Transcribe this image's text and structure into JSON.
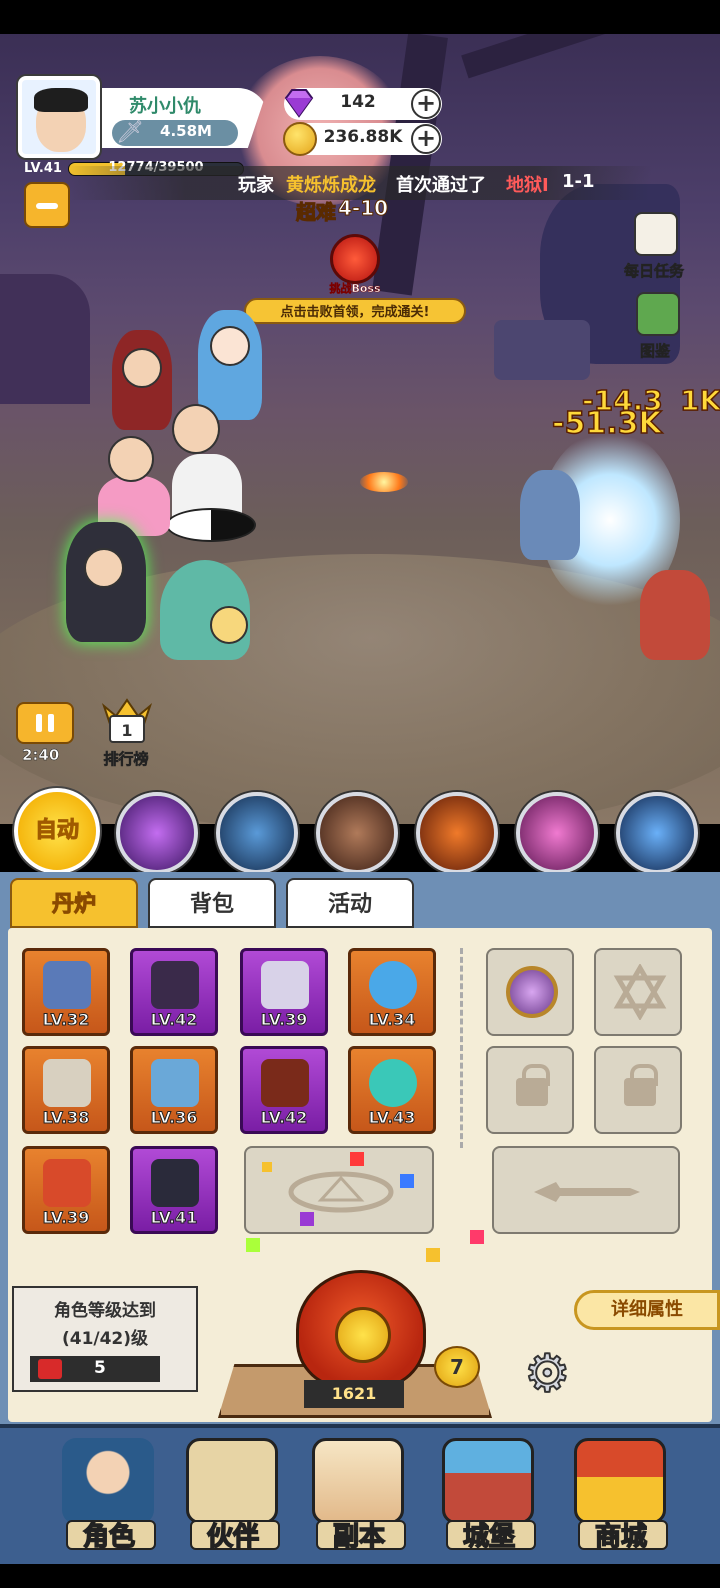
{
  "player": {
    "name": "苏小小仇",
    "power": "4.58M",
    "level": "LV.41",
    "xp": "12774/39500",
    "xp_fraction": 0.323
  },
  "currency": {
    "gems": "142",
    "coins": "236.88K"
  },
  "broadcast": {
    "prefix": "玩家",
    "player": "黄烁烁成龙",
    "middle": "首次通过了",
    "place": "地狱I",
    "stage_num": "1-1"
  },
  "stage": {
    "difficulty": "超难",
    "number": "4-10"
  },
  "boss": {
    "label": "挑战Boss",
    "hint": "点击击败首领，完成通关!"
  },
  "side_menu": {
    "daily_tasks": "每日任务",
    "codex": "图鉴"
  },
  "damage": {
    "d1": "-14.3",
    "d2": "-51.3K",
    "d3": "1K"
  },
  "controls": {
    "timer": "2:40",
    "ranking": "排行榜",
    "ranking_badge": "1",
    "auto": "自动"
  },
  "tabs": {
    "alchemy": "丹炉",
    "backpack": "背包",
    "events": "活动"
  },
  "equipment": [
    {
      "level": "LV.32",
      "rarity": "orange",
      "icon": "spear-icon"
    },
    {
      "level": "LV.42",
      "rarity": "purple",
      "icon": "bracer-icon"
    },
    {
      "level": "LV.39",
      "rarity": "purple",
      "icon": "robe-icon"
    },
    {
      "level": "LV.34",
      "rarity": "orange",
      "icon": "crane-orb-icon"
    },
    {
      "level": "LV.38",
      "rarity": "orange",
      "icon": "crown-icon"
    },
    {
      "level": "LV.36",
      "rarity": "orange",
      "icon": "bagua-icon"
    },
    {
      "level": "LV.42",
      "rarity": "purple",
      "icon": "gourd-icon"
    },
    {
      "level": "LV.43",
      "rarity": "orange",
      "icon": "pearl-icon"
    },
    {
      "level": "LV.39",
      "rarity": "orange",
      "icon": "pinwheel-icon"
    },
    {
      "level": "LV.41",
      "rarity": "purple",
      "icon": "boots-icon"
    }
  ],
  "requirement": {
    "title": "角色等级达到",
    "level": "(41/42)级",
    "cost": "5"
  },
  "furnace": {
    "count": "1621",
    "level": "7",
    "detail_button": "详细属性"
  },
  "nav": {
    "character": "角色",
    "partner": "伙伴",
    "dungeon": "副本",
    "castle": "城堡",
    "shop": "商城"
  },
  "colors": {
    "accent_gold": "#f6c12e",
    "panel_blue": "#6e8fb5",
    "nav_blue": "#3d5f8f"
  }
}
